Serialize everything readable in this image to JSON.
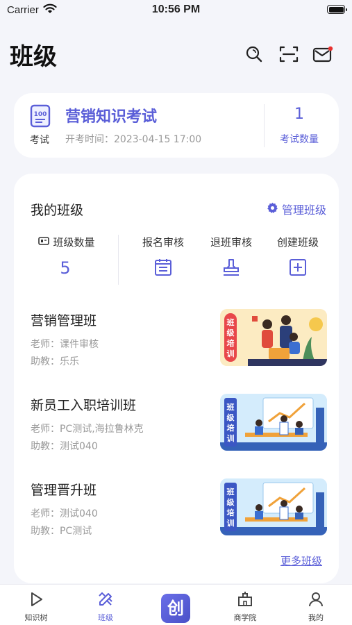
{
  "status_bar": {
    "carrier": "Carrier",
    "time": "10:56 PM"
  },
  "header": {
    "title": "班级",
    "icons": [
      "search-icon",
      "scan-icon",
      "mail-icon"
    ]
  },
  "exam": {
    "icon_label": "考试",
    "name": "营销知识考试",
    "time": "开考时间：2023-04-15 17:00",
    "count": "1",
    "count_label": "考试数量"
  },
  "my_classes": {
    "title": "我的班级",
    "manage_label": "管理班级",
    "class_count_label": "班级数量",
    "class_count": "5",
    "actions": [
      {
        "label": "报名审核",
        "icon": "clipboard-icon"
      },
      {
        "label": "退班审核",
        "icon": "stamp-icon"
      },
      {
        "label": "创建班级",
        "icon": "plus-square-icon"
      }
    ],
    "classes": [
      {
        "name": "营销管理班",
        "teacher": "老师：课件审核",
        "assistant": "助教：乐乐",
        "badge": "班级培训"
      },
      {
        "name": "新员工入职培训班",
        "teacher": "老师：PC测试,海拉鲁林克",
        "assistant": "助教：测试040",
        "badge": "班级培训"
      },
      {
        "name": "管理晋升班",
        "teacher": "老师：测试040",
        "assistant": "助教：PC测试",
        "badge": "班级培训"
      }
    ],
    "more_label": "更多班级"
  },
  "tabbar": {
    "items": [
      {
        "label": "知识树",
        "icon": "play-icon"
      },
      {
        "label": "班级",
        "icon": "pencil-ruler-icon",
        "active": true
      },
      {
        "label": "",
        "icon": "app-logo-icon",
        "logo_text": "创"
      },
      {
        "label": "商学院",
        "icon": "building-icon"
      },
      {
        "label": "我的",
        "icon": "user-icon"
      }
    ]
  },
  "colors": {
    "accent": "#5a5ed8",
    "background": "#f4f5fa",
    "notification_dot": "#e8312f"
  }
}
